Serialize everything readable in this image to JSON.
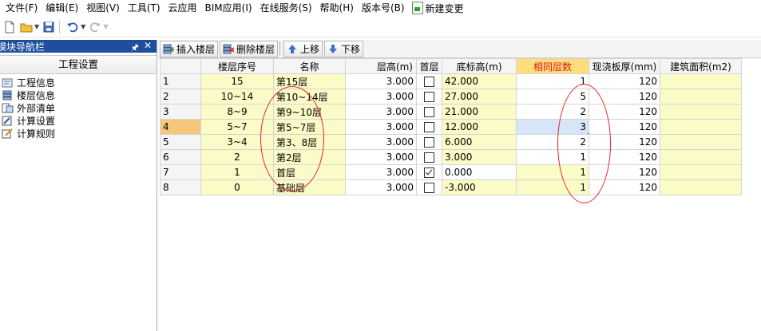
{
  "menubar": {
    "items": [
      "文件(F)",
      "编辑(E)",
      "视图(V)",
      "工具(T)",
      "云应用",
      "BIM应用(I)",
      "在线服务(S)",
      "帮助(H)",
      "版本号(B)"
    ],
    "new_change": "新建变更"
  },
  "nav": {
    "title": "模块导航栏",
    "pin_icon": "pin-icon",
    "close_icon": "close-icon",
    "section": "工程设置",
    "items": [
      {
        "label": "工程信息",
        "icon": "project-info-icon"
      },
      {
        "label": "楼层信息",
        "icon": "floor-info-icon"
      },
      {
        "label": "外部清单",
        "icon": "external-list-icon"
      },
      {
        "label": "计算设置",
        "icon": "calc-settings-icon"
      },
      {
        "label": "计算规则",
        "icon": "calc-rules-icon"
      }
    ]
  },
  "grid_toolbar": {
    "insert_floor": "插入楼层",
    "delete_floor": "删除楼层",
    "move_up": "上移",
    "move_down": "下移"
  },
  "table": {
    "headers": [
      "",
      "楼层序号",
      "名称",
      "层高(m)",
      "首层",
      "底标高(m)",
      "相同层数",
      "现浇板厚(mm)",
      "建筑面积(m2)"
    ],
    "rows": [
      {
        "n": "1",
        "seq": "15",
        "name": "第15层",
        "height": "3.000",
        "first": false,
        "base": "42.000",
        "same": "1",
        "slab": "120",
        "area": ""
      },
      {
        "n": "2",
        "seq": "10~14",
        "name": "第10~14层",
        "height": "3.000",
        "first": false,
        "base": "27.000",
        "same": "5",
        "slab": "120",
        "area": ""
      },
      {
        "n": "3",
        "seq": "8~9",
        "name": "第9~10层",
        "height": "3.000",
        "first": false,
        "base": "21.000",
        "same": "2",
        "slab": "120",
        "area": ""
      },
      {
        "n": "4",
        "seq": "5~7",
        "name": "第5~7层",
        "height": "3.000",
        "first": false,
        "base": "12.000",
        "same": "3",
        "slab": "120",
        "area": ""
      },
      {
        "n": "5",
        "seq": "3~4",
        "name": "第3、8层",
        "height": "3.000",
        "first": false,
        "base": "6.000",
        "same": "2",
        "slab": "120",
        "area": ""
      },
      {
        "n": "6",
        "seq": "2",
        "name": "第2层",
        "height": "3.000",
        "first": false,
        "base": "3.000",
        "same": "1",
        "slab": "120",
        "area": ""
      },
      {
        "n": "7",
        "seq": "1",
        "name": "首层",
        "height": "3.000",
        "first": true,
        "base": "0.000",
        "same": "1",
        "slab": "120",
        "area": ""
      },
      {
        "n": "8",
        "seq": "0",
        "name": "基础层",
        "height": "3.000",
        "first": false,
        "base": "-3.000",
        "same": "1",
        "slab": "120",
        "area": ""
      }
    ],
    "active_row": 3
  },
  "colors": {
    "header_highlight": "#ffdd7a",
    "yellow_cell": "#fbfbc8",
    "annotation": "#e3242b",
    "nav_title": "#1e4f9e"
  }
}
